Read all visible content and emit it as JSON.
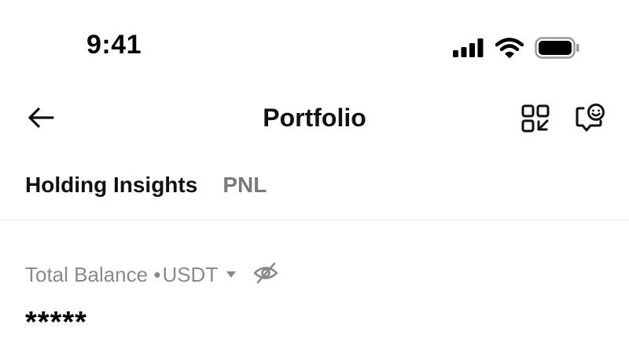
{
  "status_bar": {
    "time": "9:41",
    "icons": [
      "cellular-signal-icon",
      "wifi-icon",
      "battery-icon"
    ]
  },
  "header": {
    "title": "Portfolio",
    "back_icon": "arrow-left-icon",
    "actions": [
      {
        "name": "qr-scan",
        "icon": "qr-code-icon"
      },
      {
        "name": "support-chat",
        "icon": "smiley-chat-icon"
      }
    ]
  },
  "tabs": [
    {
      "label": "Holding Insights",
      "active": true
    },
    {
      "label": "PNL",
      "active": false
    }
  ],
  "balance": {
    "label": "Total Balance • ",
    "currency": "USDT",
    "value": "*****",
    "visibility_icon": "eye-off-icon"
  },
  "colors": {
    "text_primary": "#111111",
    "text_secondary": "#8a8a8a",
    "tab_inactive": "#7a7a7a",
    "divider": "#ececec",
    "background": "#ffffff"
  }
}
